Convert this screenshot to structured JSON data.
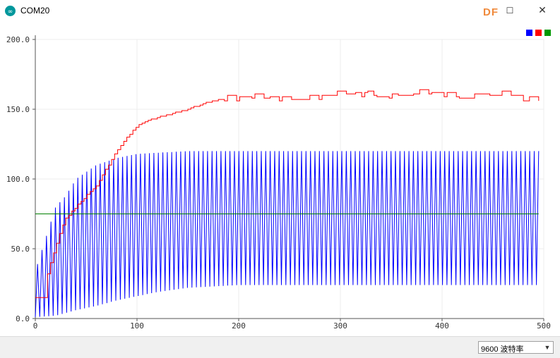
{
  "window": {
    "title": "COM20",
    "logo_text": "DF",
    "minimize": "—",
    "maximize": "☐",
    "close": "✕"
  },
  "legend": {
    "colors": [
      "#0000ff",
      "#ff0000",
      "#009900"
    ]
  },
  "baud": {
    "value": "9600 波特率"
  },
  "chart_data": {
    "type": "line",
    "xlim": [
      0,
      500
    ],
    "ylim": [
      0,
      200
    ],
    "x_ticks": [
      "0",
      "100",
      "200",
      "300",
      "400",
      "500"
    ],
    "y_ticks": [
      "0.0",
      "50.0",
      "100.0",
      "150.0",
      "200.0"
    ],
    "grid": true,
    "legend_position": "top-right",
    "series": [
      {
        "color": "#0000ff",
        "style": "oscillating",
        "x_range": [
          0,
          495
        ],
        "period": 4.4,
        "envelope_max": [
          [
            0,
            34
          ],
          [
            20,
            80
          ],
          [
            30,
            88
          ],
          [
            40,
            100
          ],
          [
            60,
            110
          ],
          [
            80,
            115
          ],
          [
            100,
            118
          ],
          [
            150,
            120
          ],
          [
            495,
            120
          ]
        ],
        "envelope_min": [
          [
            0,
            1
          ],
          [
            20,
            2
          ],
          [
            40,
            6
          ],
          [
            60,
            9
          ],
          [
            80,
            13
          ],
          [
            100,
            16
          ],
          [
            120,
            19
          ],
          [
            150,
            22
          ],
          [
            200,
            24
          ],
          [
            495,
            24
          ]
        ]
      },
      {
        "color": "#ff0000",
        "style": "step",
        "x_range": [
          0,
          495
        ],
        "points": [
          [
            0,
            15
          ],
          [
            10,
            15
          ],
          [
            10,
            27
          ],
          [
            15,
            40
          ],
          [
            20,
            52
          ],
          [
            25,
            63
          ],
          [
            30,
            72
          ],
          [
            40,
            80
          ],
          [
            50,
            88
          ],
          [
            60,
            95
          ],
          [
            70,
            108
          ],
          [
            80,
            120
          ],
          [
            90,
            130
          ],
          [
            100,
            138
          ],
          [
            110,
            142
          ],
          [
            130,
            146
          ],
          [
            150,
            150
          ],
          [
            170,
            155
          ],
          [
            190,
            158
          ],
          [
            200,
            157
          ],
          [
            220,
            156
          ],
          [
            260,
            158
          ],
          [
            300,
            158
          ],
          [
            330,
            161
          ],
          [
            360,
            158
          ],
          [
            400,
            160
          ],
          [
            430,
            159
          ],
          [
            460,
            158
          ],
          [
            495,
            157
          ]
        ]
      },
      {
        "color": "#008000",
        "style": "flat",
        "y": 75,
        "x_range": [
          0,
          495
        ]
      }
    ]
  }
}
